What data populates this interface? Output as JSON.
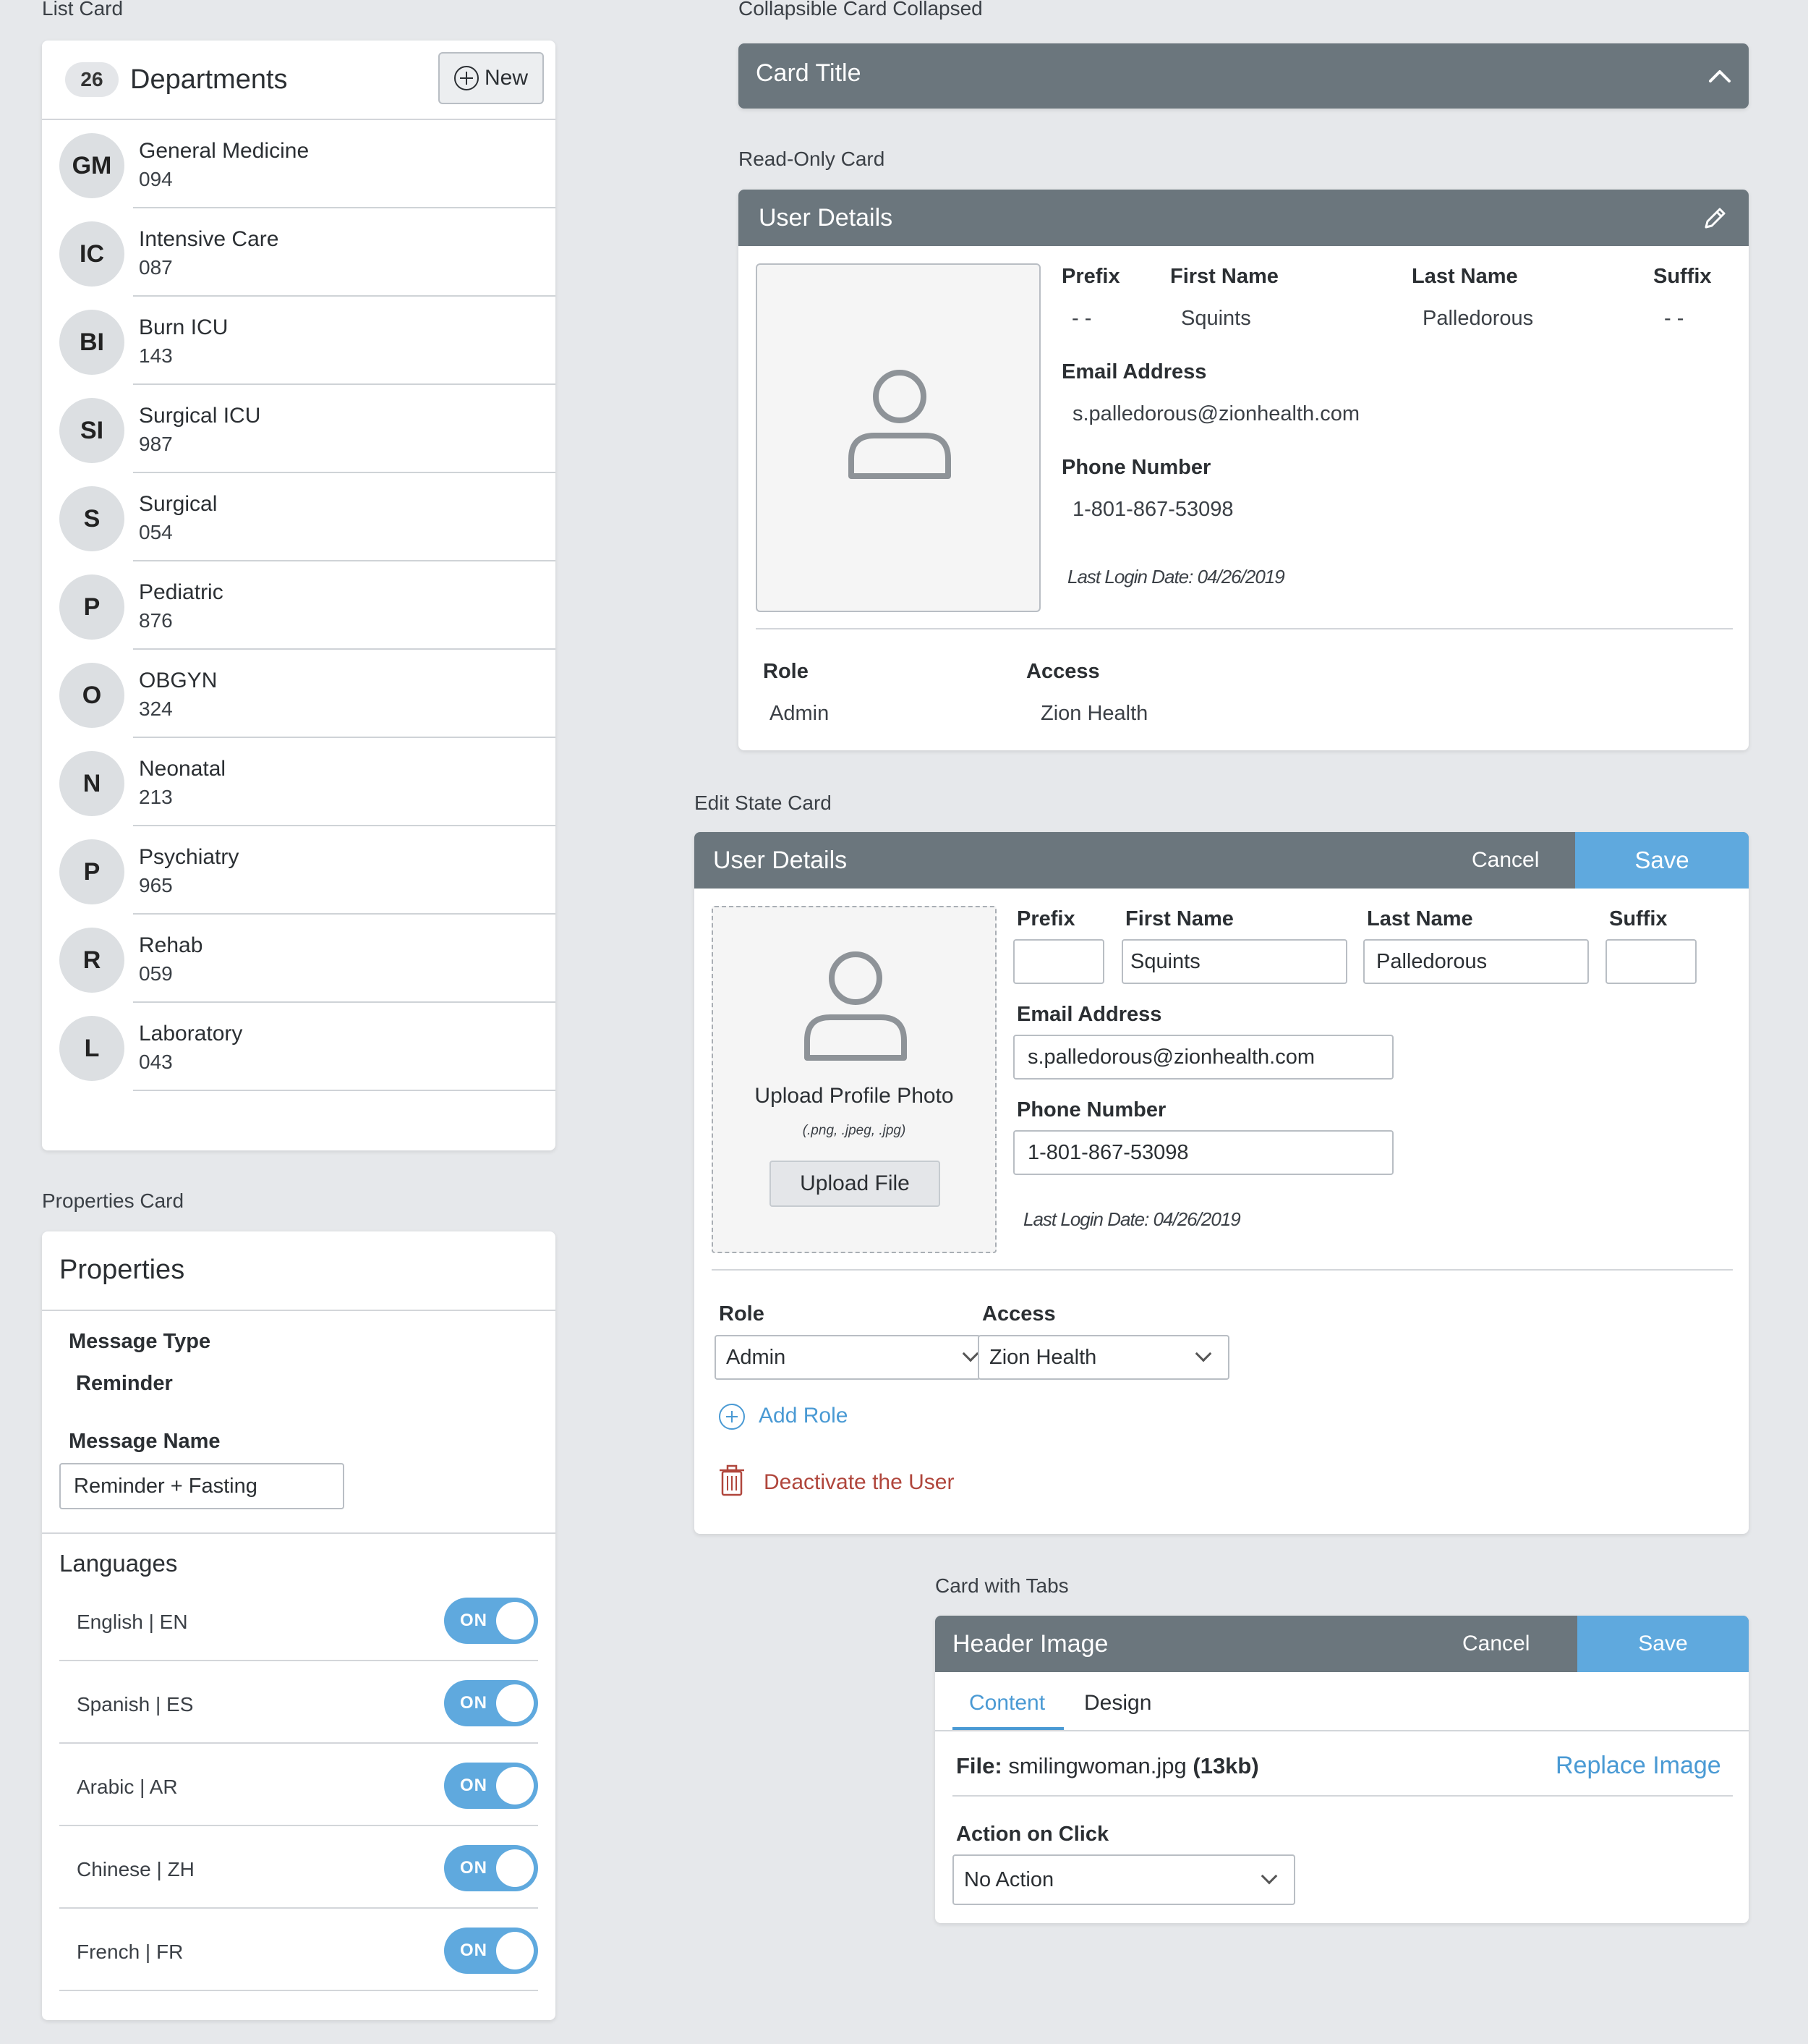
{
  "sections": {
    "list_card": "List Card",
    "collapsible_card": "Collapsible Card Collapsed",
    "read_only_card": "Read-Only Card",
    "edit_state_card": "Edit State Card",
    "properties_card": "Properties Card",
    "card_with_tabs": "Card with Tabs"
  },
  "list_card": {
    "count": "26",
    "title": "Departments",
    "new_label": "New",
    "items": [
      {
        "initials": "GM",
        "name": "General Medicine",
        "code": "094"
      },
      {
        "initials": "IC",
        "name": "Intensive Care",
        "code": "087"
      },
      {
        "initials": "BI",
        "name": "Burn ICU",
        "code": "143"
      },
      {
        "initials": "SI",
        "name": "Surgical ICU",
        "code": "987"
      },
      {
        "initials": "S",
        "name": "Surgical",
        "code": "054"
      },
      {
        "initials": "P",
        "name": "Pediatric",
        "code": "876"
      },
      {
        "initials": "O",
        "name": "OBGYN",
        "code": "324"
      },
      {
        "initials": "N",
        "name": "Neonatal",
        "code": "213"
      },
      {
        "initials": "P",
        "name": "Psychiatry",
        "code": "965"
      },
      {
        "initials": "R",
        "name": "Rehab",
        "code": "059"
      },
      {
        "initials": "L",
        "name": "Laboratory",
        "code": "043"
      }
    ]
  },
  "properties_card": {
    "title": "Properties",
    "message_type_label": "Message Type",
    "message_type_value": "Reminder",
    "message_name_label": "Message Name",
    "message_name_value": "Reminder + Fasting",
    "languages_label": "Languages",
    "languages": [
      {
        "name": "English | EN",
        "state": "ON"
      },
      {
        "name": "Spanish | ES",
        "state": "ON"
      },
      {
        "name": "Arabic | AR",
        "state": "ON"
      },
      {
        "name": "Chinese | ZH",
        "state": "ON"
      },
      {
        "name": "French | FR",
        "state": "ON"
      }
    ]
  },
  "collapsible_card": {
    "title": "Card Title"
  },
  "read_only_card": {
    "title": "User Details",
    "prefix_label": "Prefix",
    "prefix_value": "- -",
    "first_name_label": "First Name",
    "first_name_value": "Squints",
    "last_name_label": "Last Name",
    "last_name_value": "Palledorous",
    "suffix_label": "Suffix",
    "suffix_value": "- -",
    "email_label": "Email Address",
    "email_value": "s.palledorous@zionhealth.com",
    "phone_label": "Phone Number",
    "phone_value": "1-801-867-53098",
    "last_login": "Last Login Date: 04/26/2019",
    "role_label": "Role",
    "role_value": "Admin",
    "access_label": "Access",
    "access_value": "Zion Health"
  },
  "edit_card": {
    "title": "User Details",
    "cancel": "Cancel",
    "save": "Save",
    "upload_title": "Upload Profile Photo",
    "upload_formats": "(.png, .jpeg, .jpg)",
    "upload_button": "Upload File",
    "prefix_label": "Prefix",
    "prefix_value": "",
    "first_name_label": "First Name",
    "first_name_value": "Squints",
    "last_name_label": "Last Name",
    "last_name_value": "Palledorous",
    "suffix_label": "Suffix",
    "suffix_value": "",
    "email_label": "Email Address",
    "email_value": "s.palledorous@zionhealth.com",
    "phone_label": "Phone Number",
    "phone_value": "1-801-867-53098",
    "last_login": "Last Login Date: 04/26/2019",
    "role_label": "Role",
    "role_value": "Admin",
    "access_label": "Access",
    "access_value": "Zion Health",
    "add_role": "Add Role",
    "deactivate": "Deactivate the User"
  },
  "tabs_card": {
    "title": "Header Image",
    "cancel": "Cancel",
    "save": "Save",
    "tabs": [
      "Content",
      "Design"
    ],
    "active_tab": "Content",
    "file_label": "File:",
    "file_name": "smilingwoman.jpg",
    "file_size": "(13kb)",
    "replace": "Replace Image",
    "action_label": "Action on Click",
    "action_value": "No Action"
  },
  "colors": {
    "header": "#6b767d",
    "accent_blue": "#5fa9de",
    "link_blue": "#4a9ad4",
    "danger": "#b0463c",
    "background": "#e6e8eb"
  },
  "icons": [
    "plus-circle-icon",
    "person-icon",
    "pencil-icon",
    "chevron-up-icon",
    "chevron-down-icon",
    "trash-icon"
  ]
}
